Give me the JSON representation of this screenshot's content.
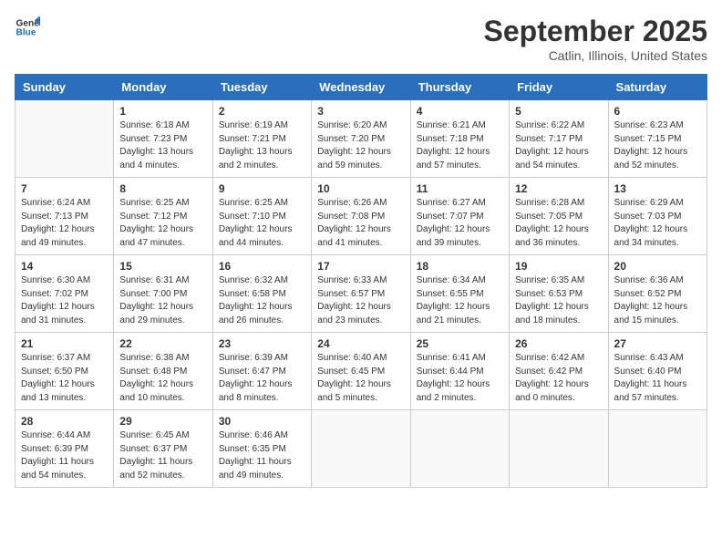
{
  "logo": {
    "line1": "General",
    "line2": "Blue"
  },
  "title": "September 2025",
  "location": "Catlin, Illinois, United States",
  "weekdays": [
    "Sunday",
    "Monday",
    "Tuesday",
    "Wednesday",
    "Thursday",
    "Friday",
    "Saturday"
  ],
  "weeks": [
    [
      {
        "day": "",
        "info": ""
      },
      {
        "day": "1",
        "info": "Sunrise: 6:18 AM\nSunset: 7:23 PM\nDaylight: 13 hours\nand 4 minutes."
      },
      {
        "day": "2",
        "info": "Sunrise: 6:19 AM\nSunset: 7:21 PM\nDaylight: 13 hours\nand 2 minutes."
      },
      {
        "day": "3",
        "info": "Sunrise: 6:20 AM\nSunset: 7:20 PM\nDaylight: 12 hours\nand 59 minutes."
      },
      {
        "day": "4",
        "info": "Sunrise: 6:21 AM\nSunset: 7:18 PM\nDaylight: 12 hours\nand 57 minutes."
      },
      {
        "day": "5",
        "info": "Sunrise: 6:22 AM\nSunset: 7:17 PM\nDaylight: 12 hours\nand 54 minutes."
      },
      {
        "day": "6",
        "info": "Sunrise: 6:23 AM\nSunset: 7:15 PM\nDaylight: 12 hours\nand 52 minutes."
      }
    ],
    [
      {
        "day": "7",
        "info": "Sunrise: 6:24 AM\nSunset: 7:13 PM\nDaylight: 12 hours\nand 49 minutes."
      },
      {
        "day": "8",
        "info": "Sunrise: 6:25 AM\nSunset: 7:12 PM\nDaylight: 12 hours\nand 47 minutes."
      },
      {
        "day": "9",
        "info": "Sunrise: 6:25 AM\nSunset: 7:10 PM\nDaylight: 12 hours\nand 44 minutes."
      },
      {
        "day": "10",
        "info": "Sunrise: 6:26 AM\nSunset: 7:08 PM\nDaylight: 12 hours\nand 41 minutes."
      },
      {
        "day": "11",
        "info": "Sunrise: 6:27 AM\nSunset: 7:07 PM\nDaylight: 12 hours\nand 39 minutes."
      },
      {
        "day": "12",
        "info": "Sunrise: 6:28 AM\nSunset: 7:05 PM\nDaylight: 12 hours\nand 36 minutes."
      },
      {
        "day": "13",
        "info": "Sunrise: 6:29 AM\nSunset: 7:03 PM\nDaylight: 12 hours\nand 34 minutes."
      }
    ],
    [
      {
        "day": "14",
        "info": "Sunrise: 6:30 AM\nSunset: 7:02 PM\nDaylight: 12 hours\nand 31 minutes."
      },
      {
        "day": "15",
        "info": "Sunrise: 6:31 AM\nSunset: 7:00 PM\nDaylight: 12 hours\nand 29 minutes."
      },
      {
        "day": "16",
        "info": "Sunrise: 6:32 AM\nSunset: 6:58 PM\nDaylight: 12 hours\nand 26 minutes."
      },
      {
        "day": "17",
        "info": "Sunrise: 6:33 AM\nSunset: 6:57 PM\nDaylight: 12 hours\nand 23 minutes."
      },
      {
        "day": "18",
        "info": "Sunrise: 6:34 AM\nSunset: 6:55 PM\nDaylight: 12 hours\nand 21 minutes."
      },
      {
        "day": "19",
        "info": "Sunrise: 6:35 AM\nSunset: 6:53 PM\nDaylight: 12 hours\nand 18 minutes."
      },
      {
        "day": "20",
        "info": "Sunrise: 6:36 AM\nSunset: 6:52 PM\nDaylight: 12 hours\nand 15 minutes."
      }
    ],
    [
      {
        "day": "21",
        "info": "Sunrise: 6:37 AM\nSunset: 6:50 PM\nDaylight: 12 hours\nand 13 minutes."
      },
      {
        "day": "22",
        "info": "Sunrise: 6:38 AM\nSunset: 6:48 PM\nDaylight: 12 hours\nand 10 minutes."
      },
      {
        "day": "23",
        "info": "Sunrise: 6:39 AM\nSunset: 6:47 PM\nDaylight: 12 hours\nand 8 minutes."
      },
      {
        "day": "24",
        "info": "Sunrise: 6:40 AM\nSunset: 6:45 PM\nDaylight: 12 hours\nand 5 minutes."
      },
      {
        "day": "25",
        "info": "Sunrise: 6:41 AM\nSunset: 6:44 PM\nDaylight: 12 hours\nand 2 minutes."
      },
      {
        "day": "26",
        "info": "Sunrise: 6:42 AM\nSunset: 6:42 PM\nDaylight: 12 hours\nand 0 minutes."
      },
      {
        "day": "27",
        "info": "Sunrise: 6:43 AM\nSunset: 6:40 PM\nDaylight: 11 hours\nand 57 minutes."
      }
    ],
    [
      {
        "day": "28",
        "info": "Sunrise: 6:44 AM\nSunset: 6:39 PM\nDaylight: 11 hours\nand 54 minutes."
      },
      {
        "day": "29",
        "info": "Sunrise: 6:45 AM\nSunset: 6:37 PM\nDaylight: 11 hours\nand 52 minutes."
      },
      {
        "day": "30",
        "info": "Sunrise: 6:46 AM\nSunset: 6:35 PM\nDaylight: 11 hours\nand 49 minutes."
      },
      {
        "day": "",
        "info": ""
      },
      {
        "day": "",
        "info": ""
      },
      {
        "day": "",
        "info": ""
      },
      {
        "day": "",
        "info": ""
      }
    ]
  ]
}
